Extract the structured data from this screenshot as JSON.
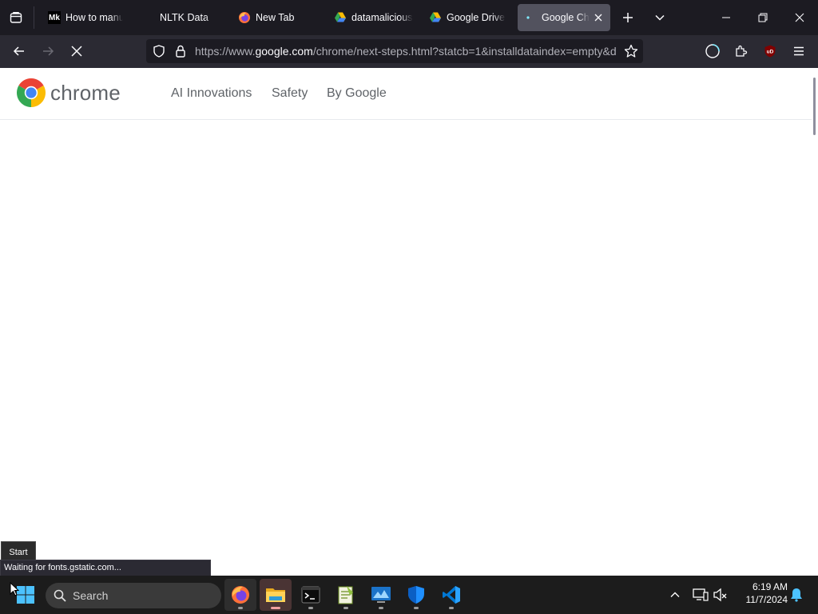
{
  "browser": {
    "tabs": [
      {
        "title": "How to manu",
        "favicon": "mk-logo-icon"
      },
      {
        "title": "NLTK Data",
        "favicon": "none"
      },
      {
        "title": "New Tab",
        "favicon": "firefox-icon"
      },
      {
        "title": "datamalicious",
        "favicon": "google-drive-icon"
      },
      {
        "title": "Google Drive",
        "favicon": "google-drive-icon"
      },
      {
        "title": "Google Chr",
        "favicon": "loading-dot-icon",
        "active": true
      }
    ],
    "mk_logo_text": "Mk",
    "url": {
      "prefix": "https://www.",
      "domain": "google.com",
      "path": "/chrome/next-steps.html?statcb=1&installdataindex=empty&d"
    },
    "extension_badge": "uD"
  },
  "page": {
    "logo_text": "chrome",
    "nav": [
      "AI Innovations",
      "Safety",
      "By Google"
    ]
  },
  "status_text": "Waiting for fonts.gstatic.com...",
  "start_tooltip": "Start",
  "taskbar": {
    "search_placeholder": "Search",
    "time": "6:19 AM",
    "date": "11/7/2024",
    "apps": [
      "firefox",
      "file-explorer",
      "terminal",
      "notepad-plus-plus",
      "remote-desktop",
      "windows-security",
      "vscode"
    ]
  },
  "colors": {
    "tab_strip": "#1c1b22",
    "nav_bar": "#2b2a33",
    "active_tab": "#52525e",
    "page_text": "#5f6368"
  }
}
